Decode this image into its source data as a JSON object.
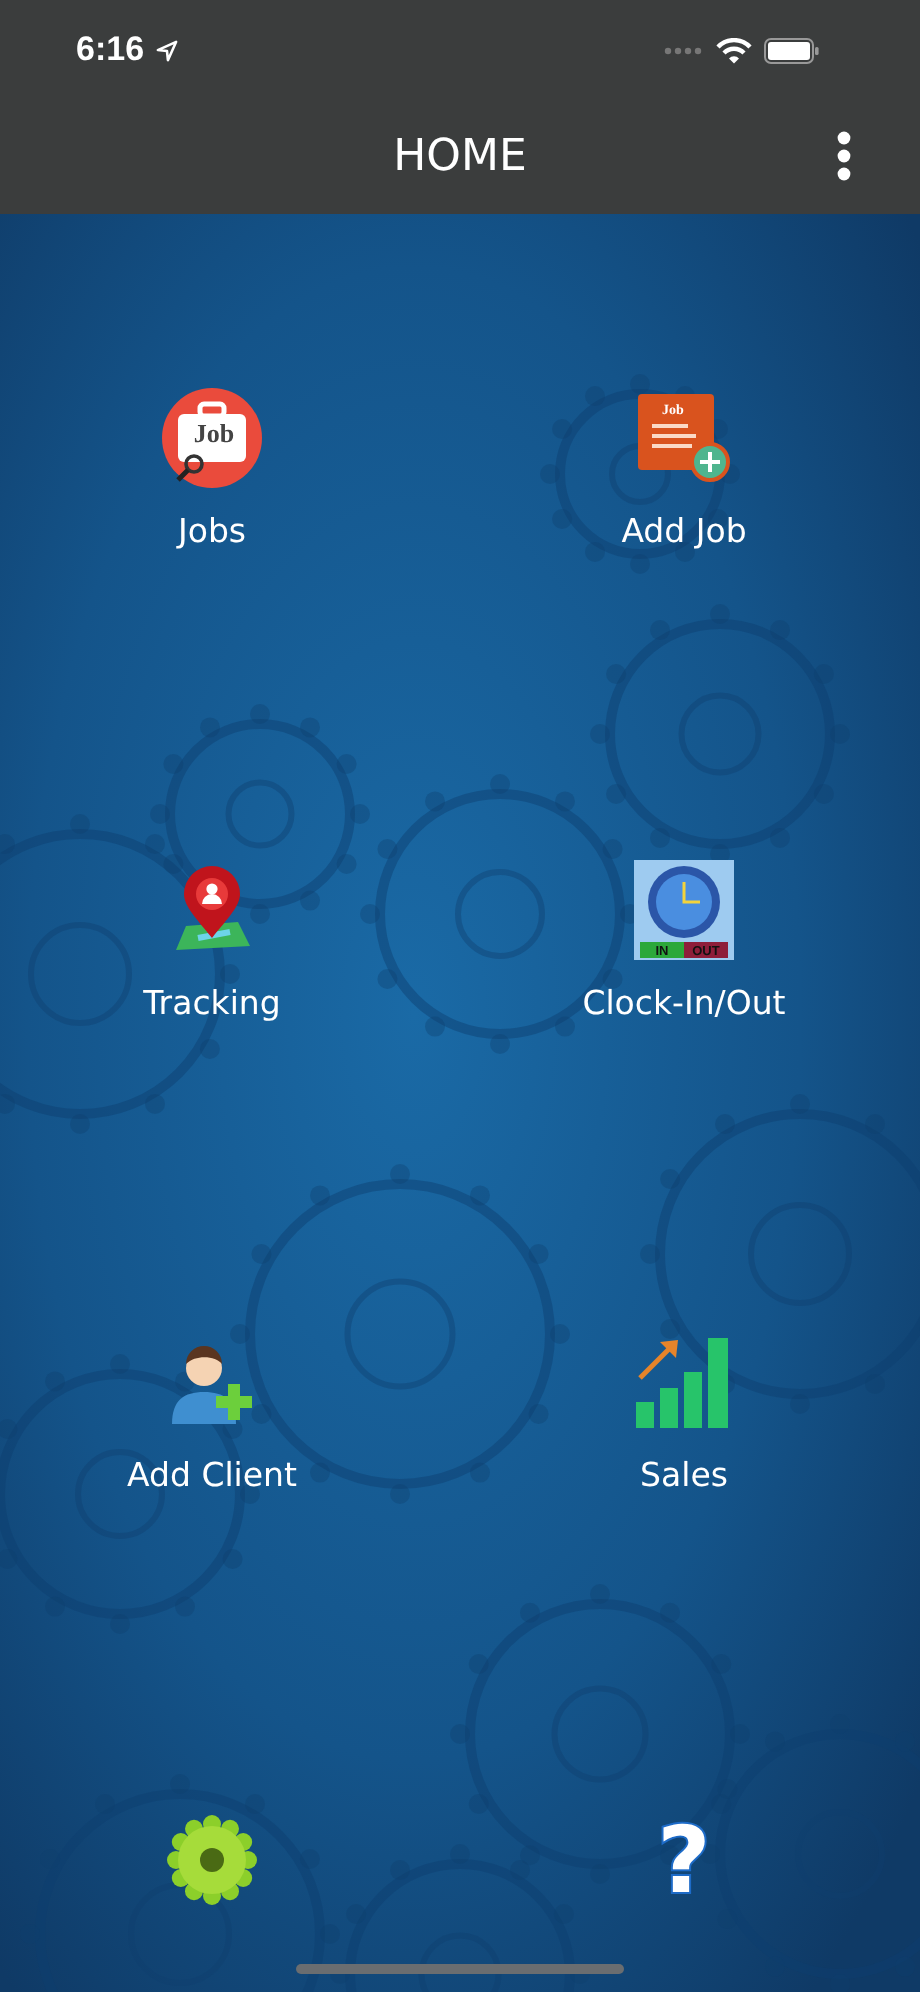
{
  "status_bar": {
    "time": "6:16"
  },
  "header": {
    "title": "HOME"
  },
  "tiles": [
    {
      "kind": "jobs",
      "label": "Jobs"
    },
    {
      "kind": "add-job",
      "label": "Add Job"
    },
    {
      "kind": "tracking",
      "label": "Tracking"
    },
    {
      "kind": "clock",
      "label": "Clock-In/Out"
    },
    {
      "kind": "add-client",
      "label": "Add Client"
    },
    {
      "kind": "sales",
      "label": "Sales"
    }
  ],
  "icon_texts": {
    "jobs": [
      "Job"
    ],
    "add-job": [
      "Job"
    ],
    "clock": [
      "IN",
      "OUT"
    ]
  },
  "bottom_icons": [
    {
      "kind": "settings"
    },
    {
      "kind": "help",
      "glyph": "?"
    }
  ]
}
